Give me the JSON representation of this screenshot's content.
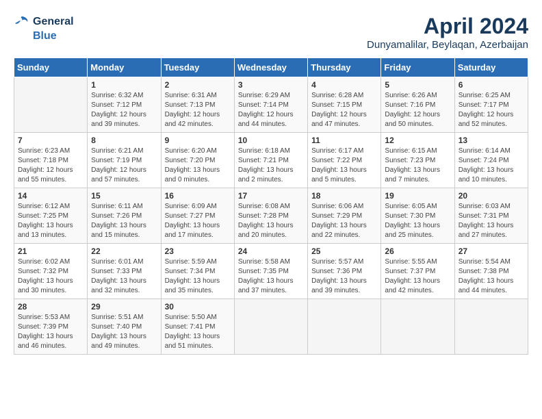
{
  "header": {
    "logo_line1": "General",
    "logo_line2": "Blue",
    "title": "April 2024",
    "location": "Dunyamalilar, Beylaqan, Azerbaijan"
  },
  "weekdays": [
    "Sunday",
    "Monday",
    "Tuesday",
    "Wednesday",
    "Thursday",
    "Friday",
    "Saturday"
  ],
  "weeks": [
    [
      {
        "day": "",
        "info": ""
      },
      {
        "day": "1",
        "info": "Sunrise: 6:32 AM\nSunset: 7:12 PM\nDaylight: 12 hours\nand 39 minutes."
      },
      {
        "day": "2",
        "info": "Sunrise: 6:31 AM\nSunset: 7:13 PM\nDaylight: 12 hours\nand 42 minutes."
      },
      {
        "day": "3",
        "info": "Sunrise: 6:29 AM\nSunset: 7:14 PM\nDaylight: 12 hours\nand 44 minutes."
      },
      {
        "day": "4",
        "info": "Sunrise: 6:28 AM\nSunset: 7:15 PM\nDaylight: 12 hours\nand 47 minutes."
      },
      {
        "day": "5",
        "info": "Sunrise: 6:26 AM\nSunset: 7:16 PM\nDaylight: 12 hours\nand 50 minutes."
      },
      {
        "day": "6",
        "info": "Sunrise: 6:25 AM\nSunset: 7:17 PM\nDaylight: 12 hours\nand 52 minutes."
      }
    ],
    [
      {
        "day": "7",
        "info": "Sunrise: 6:23 AM\nSunset: 7:18 PM\nDaylight: 12 hours\nand 55 minutes."
      },
      {
        "day": "8",
        "info": "Sunrise: 6:21 AM\nSunset: 7:19 PM\nDaylight: 12 hours\nand 57 minutes."
      },
      {
        "day": "9",
        "info": "Sunrise: 6:20 AM\nSunset: 7:20 PM\nDaylight: 13 hours\nand 0 minutes."
      },
      {
        "day": "10",
        "info": "Sunrise: 6:18 AM\nSunset: 7:21 PM\nDaylight: 13 hours\nand 2 minutes."
      },
      {
        "day": "11",
        "info": "Sunrise: 6:17 AM\nSunset: 7:22 PM\nDaylight: 13 hours\nand 5 minutes."
      },
      {
        "day": "12",
        "info": "Sunrise: 6:15 AM\nSunset: 7:23 PM\nDaylight: 13 hours\nand 7 minutes."
      },
      {
        "day": "13",
        "info": "Sunrise: 6:14 AM\nSunset: 7:24 PM\nDaylight: 13 hours\nand 10 minutes."
      }
    ],
    [
      {
        "day": "14",
        "info": "Sunrise: 6:12 AM\nSunset: 7:25 PM\nDaylight: 13 hours\nand 13 minutes."
      },
      {
        "day": "15",
        "info": "Sunrise: 6:11 AM\nSunset: 7:26 PM\nDaylight: 13 hours\nand 15 minutes."
      },
      {
        "day": "16",
        "info": "Sunrise: 6:09 AM\nSunset: 7:27 PM\nDaylight: 13 hours\nand 17 minutes."
      },
      {
        "day": "17",
        "info": "Sunrise: 6:08 AM\nSunset: 7:28 PM\nDaylight: 13 hours\nand 20 minutes."
      },
      {
        "day": "18",
        "info": "Sunrise: 6:06 AM\nSunset: 7:29 PM\nDaylight: 13 hours\nand 22 minutes."
      },
      {
        "day": "19",
        "info": "Sunrise: 6:05 AM\nSunset: 7:30 PM\nDaylight: 13 hours\nand 25 minutes."
      },
      {
        "day": "20",
        "info": "Sunrise: 6:03 AM\nSunset: 7:31 PM\nDaylight: 13 hours\nand 27 minutes."
      }
    ],
    [
      {
        "day": "21",
        "info": "Sunrise: 6:02 AM\nSunset: 7:32 PM\nDaylight: 13 hours\nand 30 minutes."
      },
      {
        "day": "22",
        "info": "Sunrise: 6:01 AM\nSunset: 7:33 PM\nDaylight: 13 hours\nand 32 minutes."
      },
      {
        "day": "23",
        "info": "Sunrise: 5:59 AM\nSunset: 7:34 PM\nDaylight: 13 hours\nand 35 minutes."
      },
      {
        "day": "24",
        "info": "Sunrise: 5:58 AM\nSunset: 7:35 PM\nDaylight: 13 hours\nand 37 minutes."
      },
      {
        "day": "25",
        "info": "Sunrise: 5:57 AM\nSunset: 7:36 PM\nDaylight: 13 hours\nand 39 minutes."
      },
      {
        "day": "26",
        "info": "Sunrise: 5:55 AM\nSunset: 7:37 PM\nDaylight: 13 hours\nand 42 minutes."
      },
      {
        "day": "27",
        "info": "Sunrise: 5:54 AM\nSunset: 7:38 PM\nDaylight: 13 hours\nand 44 minutes."
      }
    ],
    [
      {
        "day": "28",
        "info": "Sunrise: 5:53 AM\nSunset: 7:39 PM\nDaylight: 13 hours\nand 46 minutes."
      },
      {
        "day": "29",
        "info": "Sunrise: 5:51 AM\nSunset: 7:40 PM\nDaylight: 13 hours\nand 49 minutes."
      },
      {
        "day": "30",
        "info": "Sunrise: 5:50 AM\nSunset: 7:41 PM\nDaylight: 13 hours\nand 51 minutes."
      },
      {
        "day": "",
        "info": ""
      },
      {
        "day": "",
        "info": ""
      },
      {
        "day": "",
        "info": ""
      },
      {
        "day": "",
        "info": ""
      }
    ]
  ]
}
